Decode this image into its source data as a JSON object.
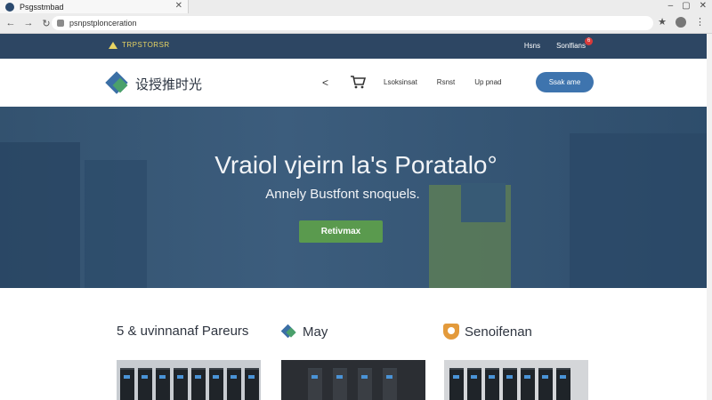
{
  "browser": {
    "tab_title": "Psgsstmbad",
    "url": "psnpstplonceration",
    "window_controls": [
      "–",
      "▢",
      "✕"
    ]
  },
  "topbar": {
    "brand": "TRPSTORSR",
    "links": [
      "Hsns",
      "Sonlfians"
    ],
    "notification_count": "6"
  },
  "nav": {
    "logo_text": "设授推时光",
    "chevron": "<",
    "links": [
      "Lsoksinsat",
      "Rsnst",
      "Up pnad"
    ],
    "search_label": "Ssak ame"
  },
  "hero": {
    "title": "Vraiol vjeirn la's Poratalo°",
    "subtitle": "Annely Bustfont snoquels.",
    "cta": "Retivmax"
  },
  "features": [
    {
      "title": "5 & uvinnanaf Pareurs",
      "icon": "none"
    },
    {
      "title": "May",
      "icon": "diamond-logo-icon"
    },
    {
      "title": "Senoifenan",
      "icon": "shield-icon"
    }
  ],
  "colors": {
    "topbar": "#2d4663",
    "hero": "#2f4e6e",
    "accent_blue": "#3e74ae",
    "accent_green": "#5a9a4e"
  }
}
